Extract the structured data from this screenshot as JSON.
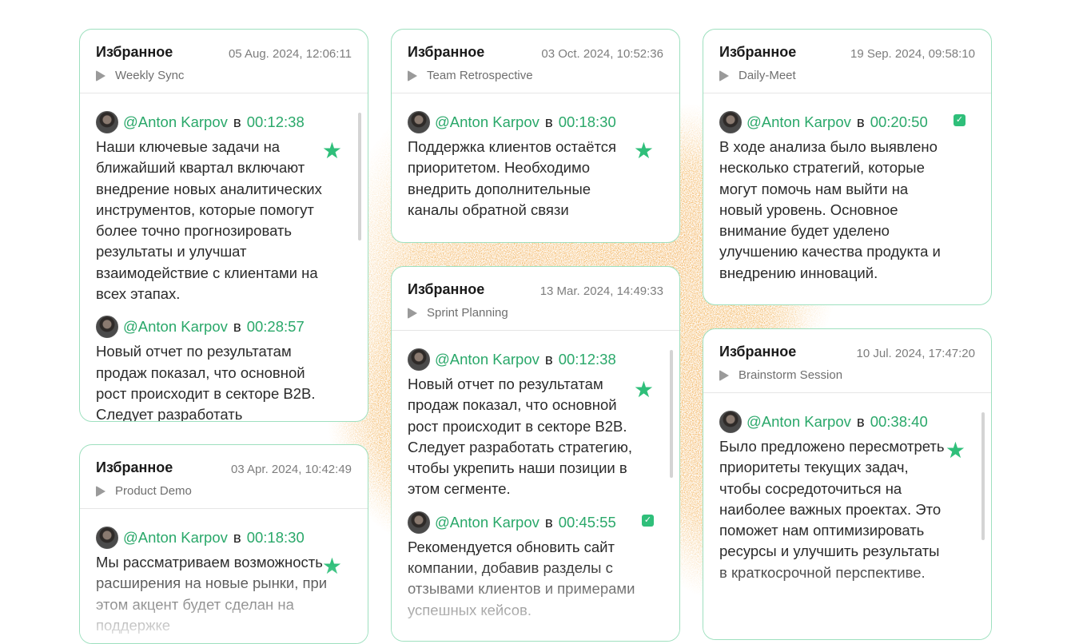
{
  "cards": [
    {
      "title": "Избранное",
      "date": "05 Aug. 2024, 12:06:11",
      "meeting": "Weekly Sync",
      "notes": [
        {
          "author": "@Anton Karpov",
          "prep": "в",
          "time": "00:12:38",
          "text": "Наши ключевые задачи на ближайший квартал включают внедрение новых аналитических инструментов, которые помогут более точно прогнозировать результаты и улучшат взаимодействие с клиентами на всех этапах.",
          "mark": "star"
        },
        {
          "author": "@Anton Karpov",
          "prep": "в",
          "time": "00:28:57",
          "text": "Новый отчет по результатам продаж показал, что основной рост происходит в секторе B2B. Следует разработать",
          "mark": "none"
        }
      ]
    },
    {
      "title": "Избранное",
      "date": "03 Oct. 2024, 10:52:36",
      "meeting": "Team Retrospective",
      "notes": [
        {
          "author": "@Anton Karpov",
          "prep": "в",
          "time": "00:18:30",
          "text": "Поддержка клиентов остаётся приоритетом. Необходимо внедрить дополнительные каналы обратной связи",
          "mark": "star"
        }
      ]
    },
    {
      "title": "Избранное",
      "date": "19 Sep. 2024, 09:58:10",
      "meeting": "Daily-Meet",
      "notes": [
        {
          "author": "@Anton Karpov",
          "prep": "в",
          "time": "00:20:50",
          "text": "В ходе анализа было выявлено несколько стратегий, которые могут помочь нам выйти на новый уровень. Основное внимание будет уделено улучшению качества продукта и внедрению инноваций.",
          "mark": "check"
        }
      ]
    },
    {
      "title": "Избранное",
      "date": "13 Mar. 2024, 14:49:33",
      "meeting": "Sprint Planning",
      "notes": [
        {
          "author": "@Anton Karpov",
          "prep": "в",
          "time": "00:12:38",
          "text": "Новый отчет по результатам продаж показал, что основной рост происходит в секторе B2B. Следует разработать стратегию, чтобы укрепить наши позиции в этом сегменте.",
          "mark": "star"
        },
        {
          "author": "@Anton Karpov",
          "prep": "в",
          "time": "00:45:55",
          "text": "Рекомендуется обновить сайт компании, добавив разделы с отзывами клиентов и примерами успешных кейсов.",
          "mark": "check"
        }
      ]
    },
    {
      "title": "Избранное",
      "date": "03 Apr. 2024, 10:42:49",
      "meeting": "Product Demo",
      "notes": [
        {
          "author": "@Anton Karpov",
          "prep": "в",
          "time": "00:18:30",
          "text": "Мы рассматриваем возможность расширения на новые рынки, при этом акцент будет сделан на поддержке",
          "mark": "star"
        }
      ]
    },
    {
      "title": "Избранное",
      "date": "10 Jul. 2024, 17:47:20",
      "meeting": "Brainstorm Session",
      "notes": [
        {
          "author": "@Anton Karpov",
          "prep": "в",
          "time": "00:38:40",
          "text": "Было предложено пересмотреть приоритеты текущих задач, чтобы сосредоточиться на наиболее важных проектах. Это поможет нам оптимизировать ресурсы и улучшить результаты в краткосрочной перспективе.",
          "mark": "star"
        }
      ]
    }
  ],
  "colors": {
    "accent": "#2aa86a",
    "star": "#2fbf7a",
    "border": "#9ee0bf",
    "splash": "#f0a43a"
  },
  "icons": {
    "meeting": "play-icon",
    "favorite": "star-icon",
    "done": "checkbox-checked-icon",
    "user": "avatar"
  }
}
